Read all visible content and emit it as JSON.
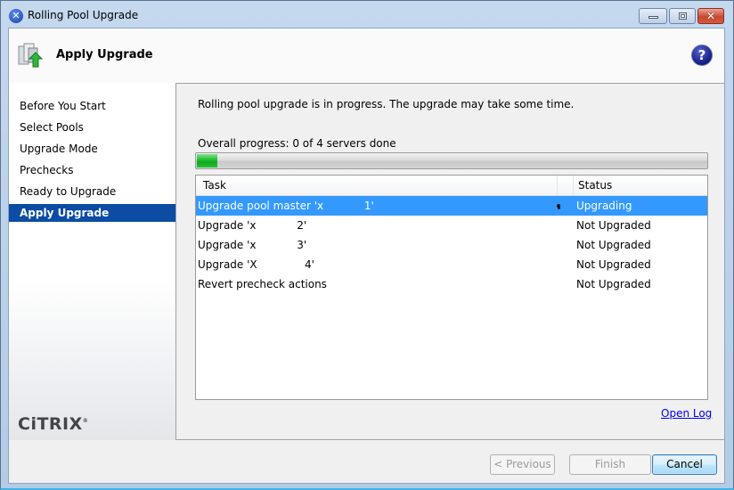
{
  "window": {
    "title": "Rolling Pool Upgrade",
    "app_icon": "xencenter-x-icon",
    "controls": {
      "minimize": "minimize-icon",
      "maximize": "maximize-icon",
      "close": "close-icon"
    },
    "glyphs": {
      "app": "✕",
      "close": "✕",
      "help": "?"
    }
  },
  "header": {
    "title": "Apply Upgrade",
    "icon": "server-upgrade-icon",
    "help_icon": "help-icon"
  },
  "sidebar": {
    "items": [
      {
        "label": "Before You Start",
        "active": false
      },
      {
        "label": "Select Pools",
        "active": false
      },
      {
        "label": "Upgrade Mode",
        "active": false
      },
      {
        "label": "Prechecks",
        "active": false
      },
      {
        "label": "Ready to Upgrade",
        "active": false
      },
      {
        "label": "Apply Upgrade",
        "active": true
      }
    ],
    "logo": {
      "text": "CiTRIX",
      "reg": "®"
    }
  },
  "main": {
    "intro": "Rolling pool upgrade is in progress. The upgrade may take some time.",
    "progress": {
      "label": "Overall progress: 0 of 4 servers done",
      "done": 0,
      "total": 4,
      "fill_fraction": 0.04
    },
    "table": {
      "columns": [
        "Task",
        "Status"
      ],
      "rows": [
        {
          "task": "Upgrade pool master 'x            1'",
          "status": "Upgrading",
          "selected": true,
          "in_progress": true
        },
        {
          "task": "Upgrade 'x            2'",
          "status": "Not Upgraded",
          "selected": false
        },
        {
          "task": "Upgrade 'x            3'",
          "status": "Not Upgraded",
          "selected": false
        },
        {
          "task": "Upgrade 'X              4'",
          "status": "Not Upgraded",
          "selected": false
        },
        {
          "task": "Revert precheck actions",
          "status": "Not Upgraded",
          "selected": false
        }
      ]
    },
    "open_log": "Open Log"
  },
  "footer": {
    "previous": {
      "label": "< Previous",
      "enabled": false
    },
    "finish": {
      "label": "Finish",
      "enabled": false
    },
    "cancel": {
      "label": "Cancel",
      "enabled": true
    }
  },
  "colors": {
    "selection": "#3399ff",
    "nav_active": "#0c4ca3",
    "progress_green": "#1fb52f",
    "link": "#0000ee"
  }
}
